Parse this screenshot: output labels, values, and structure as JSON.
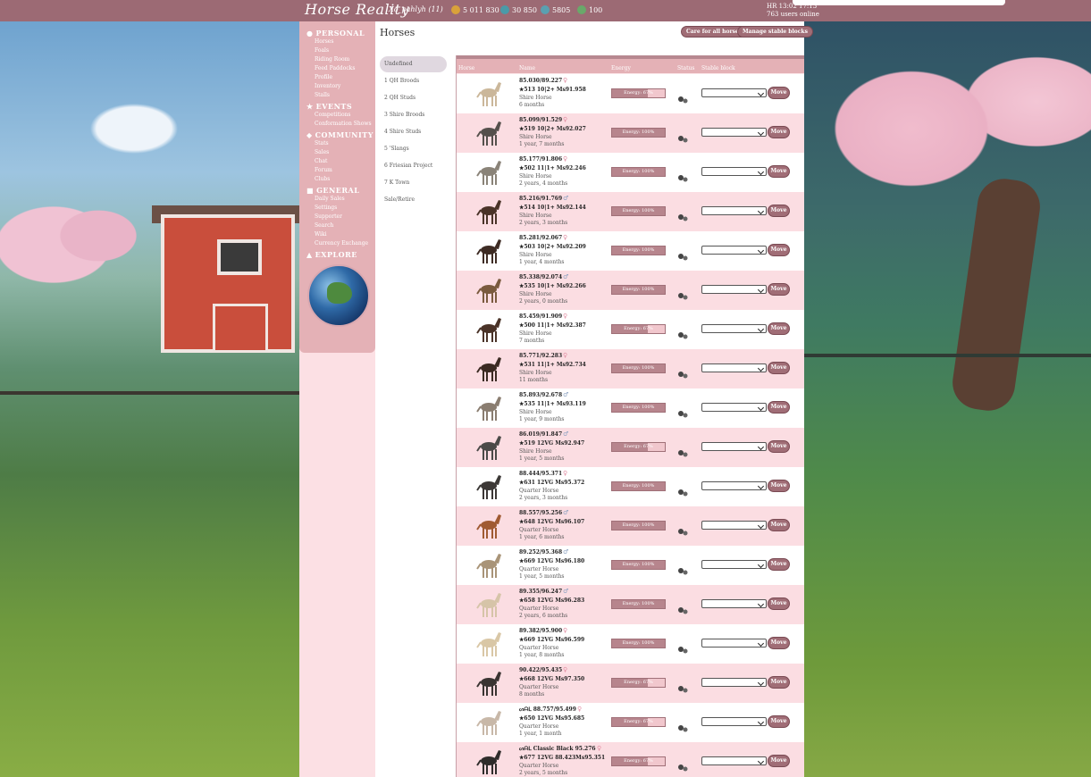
{
  "topbar": {
    "logo": "Horse Reality",
    "username": "Xo_pahlyh (11)",
    "stats": [
      {
        "icon": "gold-coin-icon",
        "value": "5 011 830",
        "color": "#d9a23a"
      },
      {
        "icon": "equus-icon",
        "value": "30 850",
        "color": "#4a9aa8"
      },
      {
        "icon": "pass-icon",
        "value": "5805",
        "color": "#5aa0b0"
      },
      {
        "icon": "energy-icon",
        "value": "100",
        "color": "#6aa86a"
      }
    ],
    "hr_time": "HR 13:02 17:13",
    "users_online": "763 users online"
  },
  "nav": {
    "sections": [
      {
        "title": "PERSONAL",
        "icon": "user-icon",
        "links": [
          "Horses",
          "Foals",
          "Riding Room",
          "Feed Paddocks",
          "Profile",
          "Inventory",
          "Stalls"
        ]
      },
      {
        "title": "EVENTS",
        "icon": "star-icon",
        "links": [
          "Competitions",
          "Conformation Shows"
        ]
      },
      {
        "title": "COMMUNITY",
        "icon": "chat-icon",
        "links": [
          "Stats",
          "Sales",
          "Chat",
          "Forum",
          "Clubs"
        ]
      },
      {
        "title": "GENERAL",
        "icon": "book-icon",
        "links": [
          "Daily Sales",
          "Settings",
          "Supporter",
          "Search",
          "Wiki",
          "Currency Exchange"
        ]
      },
      {
        "title": "EXPLORE",
        "icon": "map-icon",
        "links": []
      }
    ]
  },
  "main": {
    "title": "Horses",
    "care_button": "Care for all horses",
    "manage_button": "Manage stable blocks",
    "blocks": [
      "Undefined",
      "1 QH Broods",
      "2 QH Studs",
      "3 Shire Broods",
      "4 Shire Studs",
      "5 'Slangs",
      "6 Friesian Project",
      "7 K Town",
      "Sale/Retire"
    ],
    "columns": [
      "Horse",
      "Name",
      "Energy",
      "Status",
      "Stable block"
    ],
    "move_label": "Move",
    "rows": [
      {
        "name": "85.030/89.227",
        "sex": "mare",
        "stats": "★513 10|2+ Ms91.958",
        "breed": "Shire Horse",
        "age": "6 months",
        "energy_text": "Energy: 67%",
        "energy": 0.67,
        "coat": "#cbb79a"
      },
      {
        "name": "85.099/91.529",
        "sex": "mare",
        "stats": "★519 10|2+ Ms92.027",
        "breed": "Shire Horse",
        "age": "1 year, 7 months",
        "energy_text": "Energy: 100%",
        "energy": 1.0,
        "coat": "#55504c"
      },
      {
        "name": "85.177/91.806",
        "sex": "mare",
        "stats": "★502 11|1+ Ms92.246",
        "breed": "Shire Horse",
        "age": "2 years, 4 months",
        "energy_text": "Energy: 100%",
        "energy": 1.0,
        "coat": "#8a8378"
      },
      {
        "name": "85.216/91.769",
        "sex": "stallion",
        "stats": "★514 10|1+ Ms92.144",
        "breed": "Shire Horse",
        "age": "2 years, 3 months",
        "energy_text": "Energy: 100%",
        "energy": 1.0,
        "coat": "#4a3328"
      },
      {
        "name": "85.281/92.067",
        "sex": "mare",
        "stats": "★503 10|2+ Ms92.209",
        "breed": "Shire Horse",
        "age": "1 year, 4 months",
        "energy_text": "Energy: 100%",
        "energy": 1.0,
        "coat": "#3e2c24"
      },
      {
        "name": "85.338/92.074",
        "sex": "stallion",
        "stats": "★535 10|1+ Ms92.266",
        "breed": "Shire Horse",
        "age": "2 years, 0 months",
        "energy_text": "Energy: 100%",
        "energy": 1.0,
        "coat": "#7a5a3e"
      },
      {
        "name": "85.459/91.909",
        "sex": "mare",
        "stats": "★500 11|1+ Ms92.387",
        "breed": "Shire Horse",
        "age": "7 months",
        "energy_text": "Energy: 67%",
        "energy": 0.67,
        "coat": "#4a3328"
      },
      {
        "name": "85.771/92.283",
        "sex": "mare",
        "stats": "★531 11|1+ Ms92.734",
        "breed": "Shire Horse",
        "age": "11 months",
        "energy_text": "Energy: 100%",
        "energy": 1.0,
        "coat": "#3b2a22"
      },
      {
        "name": "85.893/92.678",
        "sex": "stallion",
        "stats": "★535 11|1+ Ms93.119",
        "breed": "Shire Horse",
        "age": "1 year, 9 months",
        "energy_text": "Energy: 100%",
        "energy": 1.0,
        "coat": "#8a7d70"
      },
      {
        "name": "86.019/91.847",
        "sex": "stallion",
        "stats": "★519 12VG Ms92.947",
        "breed": "Shire Horse",
        "age": "1 year, 5 months",
        "energy_text": "Energy: 67%",
        "energy": 0.67,
        "coat": "#4b4a48"
      },
      {
        "name": "88.444/95.371",
        "sex": "mare",
        "stats": "★631 12VG Ms95.372",
        "breed": "Quarter Horse",
        "age": "2 years, 3 months",
        "energy_text": "Energy: 100%",
        "energy": 1.0,
        "coat": "#3c3836"
      },
      {
        "name": "88.557/95.256",
        "sex": "stallion",
        "stats": "★648 12VG Ms96.107",
        "breed": "Quarter Horse",
        "age": "1 year, 6 months",
        "energy_text": "Energy: 100%",
        "energy": 1.0,
        "coat": "#a05a32"
      },
      {
        "name": "89.252/95.368",
        "sex": "stallion",
        "stats": "★669 12VG Ms96.180",
        "breed": "Quarter Horse",
        "age": "1 year, 5 months",
        "energy_text": "Energy: 100%",
        "energy": 1.0,
        "coat": "#a99478"
      },
      {
        "name": "89.355/96.247",
        "sex": "stallion",
        "stats": "★658 12VG Ms96.283",
        "breed": "Quarter Horse",
        "age": "2 years, 6 months",
        "energy_text": "Energy: 100%",
        "energy": 1.0,
        "coat": "#d6c4a8"
      },
      {
        "name": "89.382/95.900",
        "sex": "mare",
        "stats": "★669 12VG Ms96.599",
        "breed": "Quarter Horse",
        "age": "1 year, 8 months",
        "energy_text": "Energy: 100%",
        "energy": 1.0,
        "coat": "#d9c7a6"
      },
      {
        "name": "90.422/95.435",
        "sex": "mare",
        "stats": "★668 12VG Ms97.350",
        "breed": "Quarter Horse",
        "age": "8 months",
        "energy_text": "Energy: 67%",
        "energy": 0.67,
        "coat": "#3a3432"
      },
      {
        "name": "ᔕᗩᒪ 88.757/95.499",
        "sex": "mare",
        "stats": "★650 12VG Ms95.685",
        "breed": "Quarter Horse",
        "age": "1 year, 1 month",
        "energy_text": "Energy: 67%",
        "energy": 0.67,
        "coat": "#c8b8a8"
      },
      {
        "name": "ᔕᗩᒪ Classic Black 95.276",
        "sex": "mare",
        "stats": "★677 12VG 88.423Ms95.351",
        "breed": "Quarter Horse",
        "age": "2 years, 5 months",
        "energy_text": "Energy: 67%",
        "energy": 0.67,
        "coat": "#2f2c2b"
      }
    ]
  }
}
